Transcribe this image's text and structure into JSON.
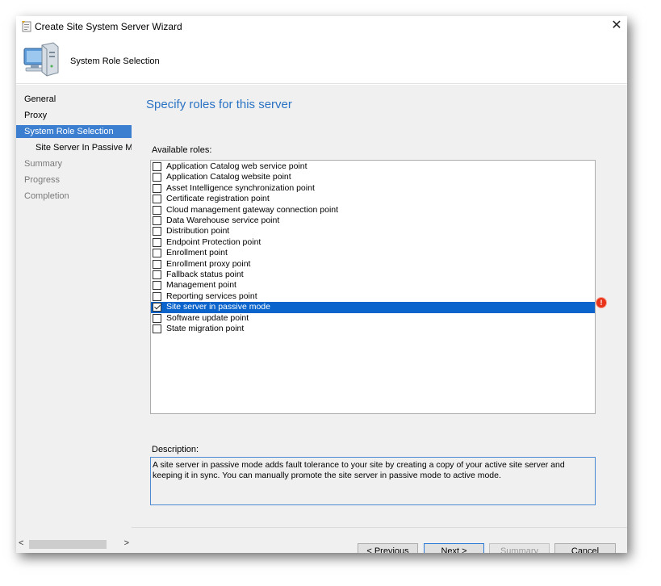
{
  "window": {
    "title": "Create Site System Server Wizard",
    "close_glyph": "✕"
  },
  "header": {
    "title": "System Role Selection",
    "icon": "server-computer-icon"
  },
  "nav": {
    "items": [
      {
        "label": "General",
        "state": "normal"
      },
      {
        "label": "Proxy",
        "state": "normal"
      },
      {
        "label": "System Role Selection",
        "state": "active"
      },
      {
        "label": "Site Server In Passive Mod",
        "state": "sub"
      },
      {
        "label": "Summary",
        "state": "disabled"
      },
      {
        "label": "Progress",
        "state": "disabled"
      },
      {
        "label": "Completion",
        "state": "disabled"
      }
    ],
    "scroll_left": "<",
    "scroll_right": ">"
  },
  "main": {
    "page_title": "Specify roles for this server",
    "available_roles_label": "Available roles:",
    "roles": [
      {
        "label": "Application Catalog web service point",
        "checked": false,
        "selected": false
      },
      {
        "label": "Application Catalog website point",
        "checked": false,
        "selected": false
      },
      {
        "label": "Asset Intelligence synchronization point",
        "checked": false,
        "selected": false
      },
      {
        "label": "Certificate registration point",
        "checked": false,
        "selected": false
      },
      {
        "label": "Cloud management gateway connection point",
        "checked": false,
        "selected": false
      },
      {
        "label": "Data Warehouse service point",
        "checked": false,
        "selected": false
      },
      {
        "label": "Distribution point",
        "checked": false,
        "selected": false
      },
      {
        "label": "Endpoint Protection point",
        "checked": false,
        "selected": false
      },
      {
        "label": "Enrollment point",
        "checked": false,
        "selected": false
      },
      {
        "label": "Enrollment proxy point",
        "checked": false,
        "selected": false
      },
      {
        "label": "Fallback status point",
        "checked": false,
        "selected": false
      },
      {
        "label": "Management point",
        "checked": false,
        "selected": false
      },
      {
        "label": "Reporting services point",
        "checked": false,
        "selected": false
      },
      {
        "label": "Site server in passive mode",
        "checked": true,
        "selected": true
      },
      {
        "label": "Software update point",
        "checked": false,
        "selected": false
      },
      {
        "label": "State migration point",
        "checked": false,
        "selected": false
      }
    ],
    "error_glyph": "!",
    "description_label": "Description:",
    "description_text": "A site server in passive mode adds fault tolerance to your site by creating a copy of your active site server and keeping it in sync. You can manually promote the site server in passive mode to active mode."
  },
  "buttons": {
    "previous": "< Previous",
    "next": "Next >",
    "summary": "Summary",
    "cancel": "Cancel"
  },
  "colors": {
    "accent": "#2a72c4",
    "selection": "#0a64cc",
    "nav_active": "#3c7fd0",
    "error": "#e8331a"
  }
}
